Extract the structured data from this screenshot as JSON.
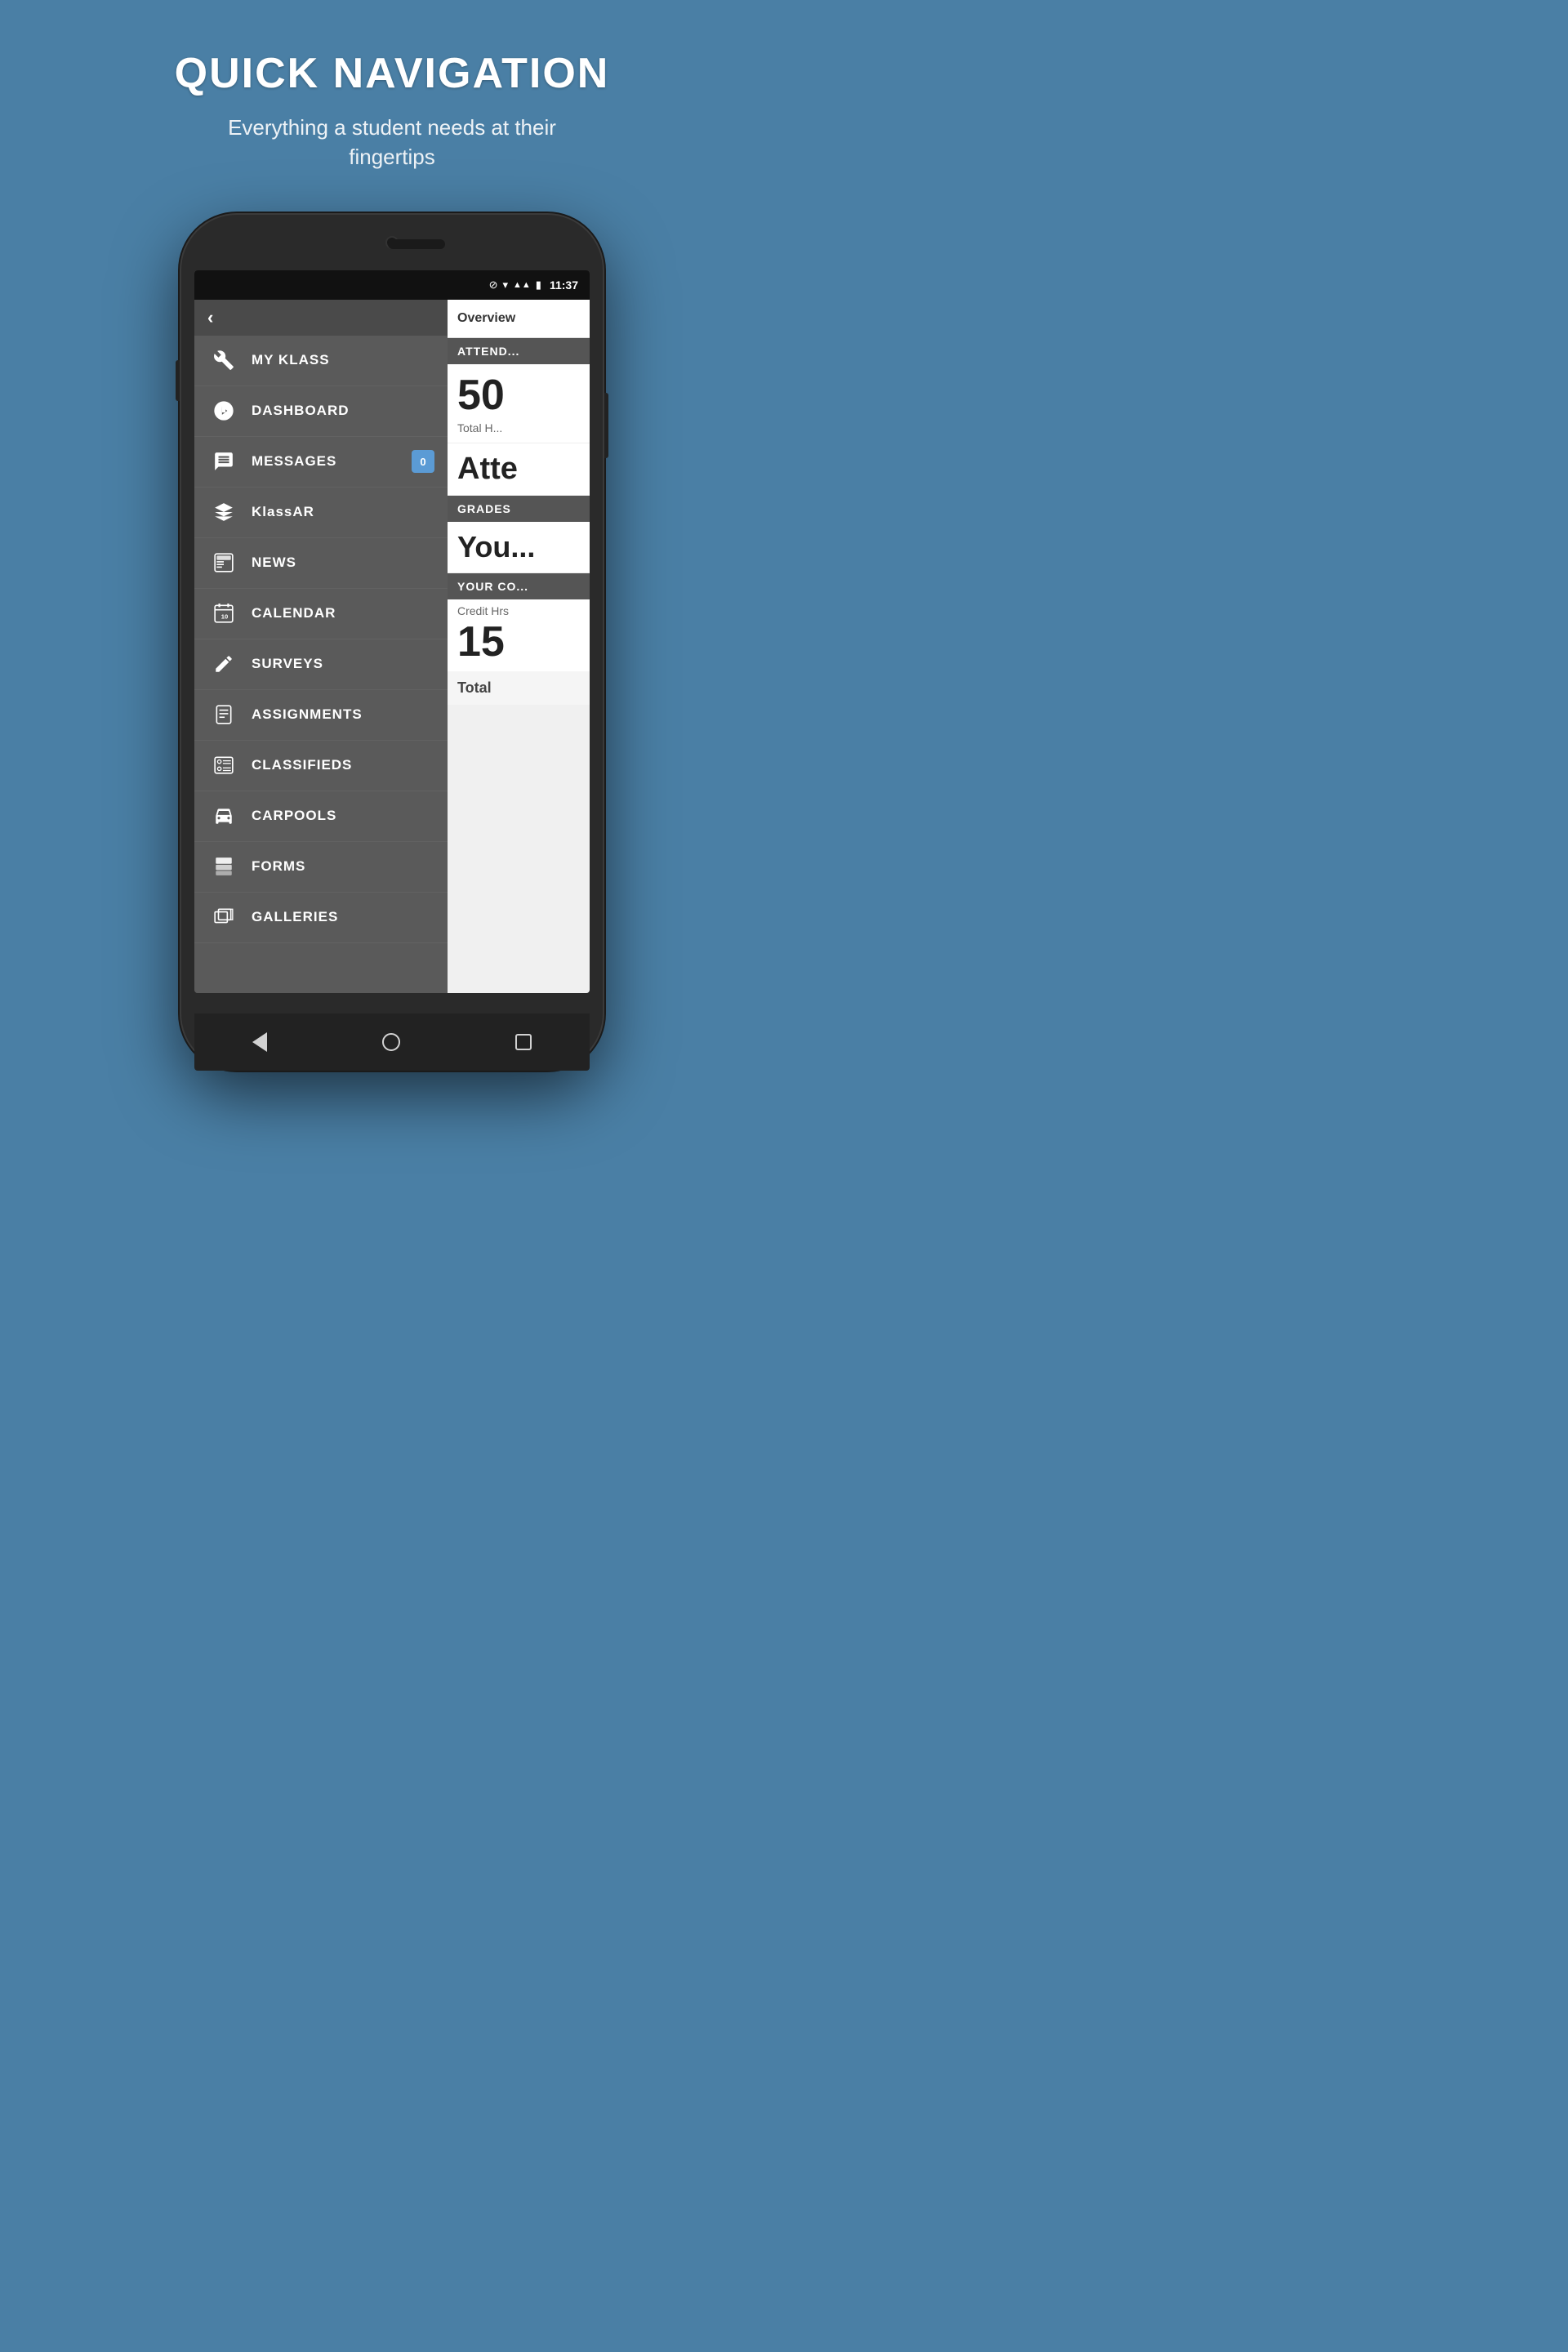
{
  "header": {
    "title": "QUICK NAVIGATION",
    "subtitle": "Everything a student needs at their fingertips"
  },
  "statusBar": {
    "time": "11:37",
    "icons": [
      "⊘",
      "▼",
      "▲▲",
      "🔋"
    ]
  },
  "backBar": {
    "chevron": "‹"
  },
  "navItems": [
    {
      "id": "my-klass",
      "label": "MY KLASS",
      "badge": null
    },
    {
      "id": "dashboard",
      "label": "DASHBOARD",
      "badge": null
    },
    {
      "id": "messages",
      "label": "MESSAGES",
      "badge": "0"
    },
    {
      "id": "klassar",
      "label": "KlassAR",
      "badge": null
    },
    {
      "id": "news",
      "label": "NEWS",
      "badge": null
    },
    {
      "id": "calendar",
      "label": "CALENDAR",
      "badge": null
    },
    {
      "id": "surveys",
      "label": "SURVEYS",
      "badge": null
    },
    {
      "id": "assignments",
      "label": "ASSIGNMENTS",
      "badge": null
    },
    {
      "id": "classifieds",
      "label": "CLASSIFIEDS",
      "badge": null
    },
    {
      "id": "carpools",
      "label": "CARPOOLS",
      "badge": null
    },
    {
      "id": "forms",
      "label": "FORMS",
      "badge": null
    },
    {
      "id": "galleries",
      "label": "GALLERIES",
      "badge": null
    },
    {
      "id": "more",
      "label": "...",
      "badge": null
    }
  ],
  "overviewPanel": {
    "header": "Overview",
    "attendance": {
      "sectionLabel": "ATTEND...",
      "number": "50",
      "subLabel": "Total H...",
      "partial": "Atte"
    },
    "grades": {
      "sectionLabel": "GRADES",
      "value": "You..."
    },
    "yourCourses": {
      "sectionLabel": "YOUR CO...",
      "creditLabel": "Credit Hrs",
      "creditNumber": "15",
      "total": "Total"
    }
  }
}
